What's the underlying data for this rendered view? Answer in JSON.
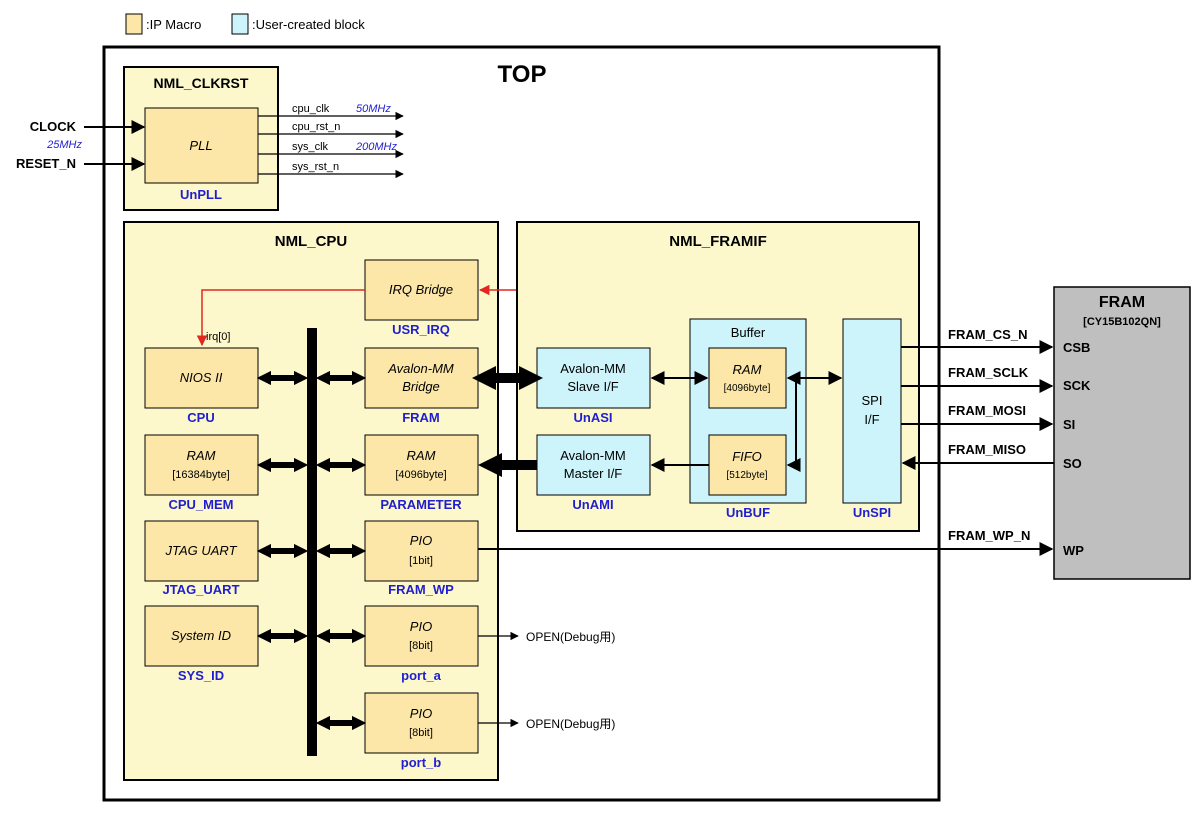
{
  "colors": {
    "ip_fill": "#fce7a8",
    "user_fill": "#ccf4fa",
    "group_fill": "#fdf7cc",
    "fram_fill": "#bfbfbf",
    "irq_line": "#e0281e",
    "blue_label": "#1f1fd0"
  },
  "legend": {
    "ip": ":IP Macro",
    "user": ":User-created block"
  },
  "top": {
    "title": "TOP"
  },
  "clkrst": {
    "title": "NML_CLKRST",
    "pll": "PLL",
    "pll_name": "UnPLL",
    "outputs": [
      {
        "name": "cpu_clk",
        "freq": "50MHz"
      },
      {
        "name": "cpu_rst_n",
        "freq": ""
      },
      {
        "name": "sys_clk",
        "freq": "200MHz"
      },
      {
        "name": "sys_rst_n",
        "freq": ""
      }
    ]
  },
  "inputs": {
    "clock": "CLOCK",
    "clock_freq": "25MHz",
    "reset": "RESET_N"
  },
  "cpu_group": {
    "title": "NML_CPU",
    "irq_bridge": {
      "label": "IRQ Bridge",
      "name": "USR_IRQ"
    },
    "irq_signal": "irq[0]",
    "left_blocks": [
      {
        "line1": "NIOS II",
        "line2": "",
        "name": "CPU"
      },
      {
        "line1": "RAM",
        "line2": "[16384byte]",
        "name": "CPU_MEM"
      },
      {
        "line1": "JTAG UART",
        "line2": "",
        "name": "JTAG_UART"
      },
      {
        "line1": "System ID",
        "line2": "",
        "name": "SYS_ID"
      }
    ],
    "right_blocks": [
      {
        "line1": "Avalon-MM",
        "line2": "Bridge",
        "name": "FRAM"
      },
      {
        "line1": "RAM",
        "line2": "[4096byte]",
        "name": "PARAMETER"
      },
      {
        "line1": "PIO",
        "line2": "[1bit]",
        "name": "FRAM_WP"
      },
      {
        "line1": "PIO",
        "line2": "[8bit]",
        "name": "port_a"
      },
      {
        "line1": "PIO",
        "line2": "[8bit]",
        "name": "port_b"
      }
    ],
    "open_label": "OPEN(Debug用)"
  },
  "framif_group": {
    "title": "NML_FRAMIF",
    "slave": {
      "line1": "Avalon-MM",
      "line2": "Slave I/F",
      "name": "UnASI"
    },
    "master": {
      "line1": "Avalon-MM",
      "line2": "Master I/F",
      "name": "UnAMI"
    },
    "buffer": {
      "title": "Buffer",
      "name": "UnBUF",
      "ram": "RAM",
      "ram_size": "[4096byte]",
      "fifo": "FIFO",
      "fifo_size": "[512byte]"
    },
    "spi": {
      "line1": "SPI",
      "line2": "I/F",
      "name": "UnSPI"
    }
  },
  "fram": {
    "title": "FRAM",
    "part": "[CY15B102QN]",
    "pins": [
      "CSB",
      "SCK",
      "SI",
      "SO",
      "WP"
    ],
    "signals": [
      "FRAM_CS_N",
      "FRAM_SCLK",
      "FRAM_MOSI",
      "FRAM_MISO",
      "FRAM_WP_N"
    ]
  }
}
